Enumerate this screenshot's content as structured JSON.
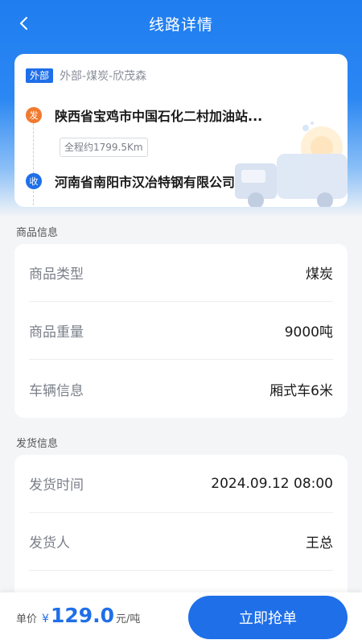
{
  "nav": {
    "title": "线路详情",
    "back_icon": "chevron-left-icon"
  },
  "route": {
    "tag": "外部",
    "tag_desc": "外部-煤炭-欣茂森",
    "origin_badge": "发",
    "origin": "陕西省宝鸡市中国石化二村加油站...",
    "distance": "全程约1799.5Km",
    "dest_badge": "收",
    "destination": "河南省南阳市汉冶特钢有限公司"
  },
  "goods": {
    "section_title": "商品信息",
    "rows": [
      {
        "label": "商品类型",
        "value": "煤炭"
      },
      {
        "label": "商品重量",
        "value": "9000吨"
      },
      {
        "label": "车辆信息",
        "value": "厢式车6米"
      }
    ]
  },
  "shipping": {
    "section_title": "发货信息",
    "rows": [
      {
        "label": "发货时间",
        "value": "2024.09.12 08:00"
      },
      {
        "label": "发货人",
        "value": "王总"
      },
      {
        "label": "",
        "value": ""
      }
    ]
  },
  "footer": {
    "price_label": "单价",
    "currency": "¥",
    "price": "129.0",
    "unit": "元/吨",
    "grab_button": "立即抢单"
  },
  "colors": {
    "primary": "#1f6fe8",
    "origin": "#f07a2f"
  }
}
